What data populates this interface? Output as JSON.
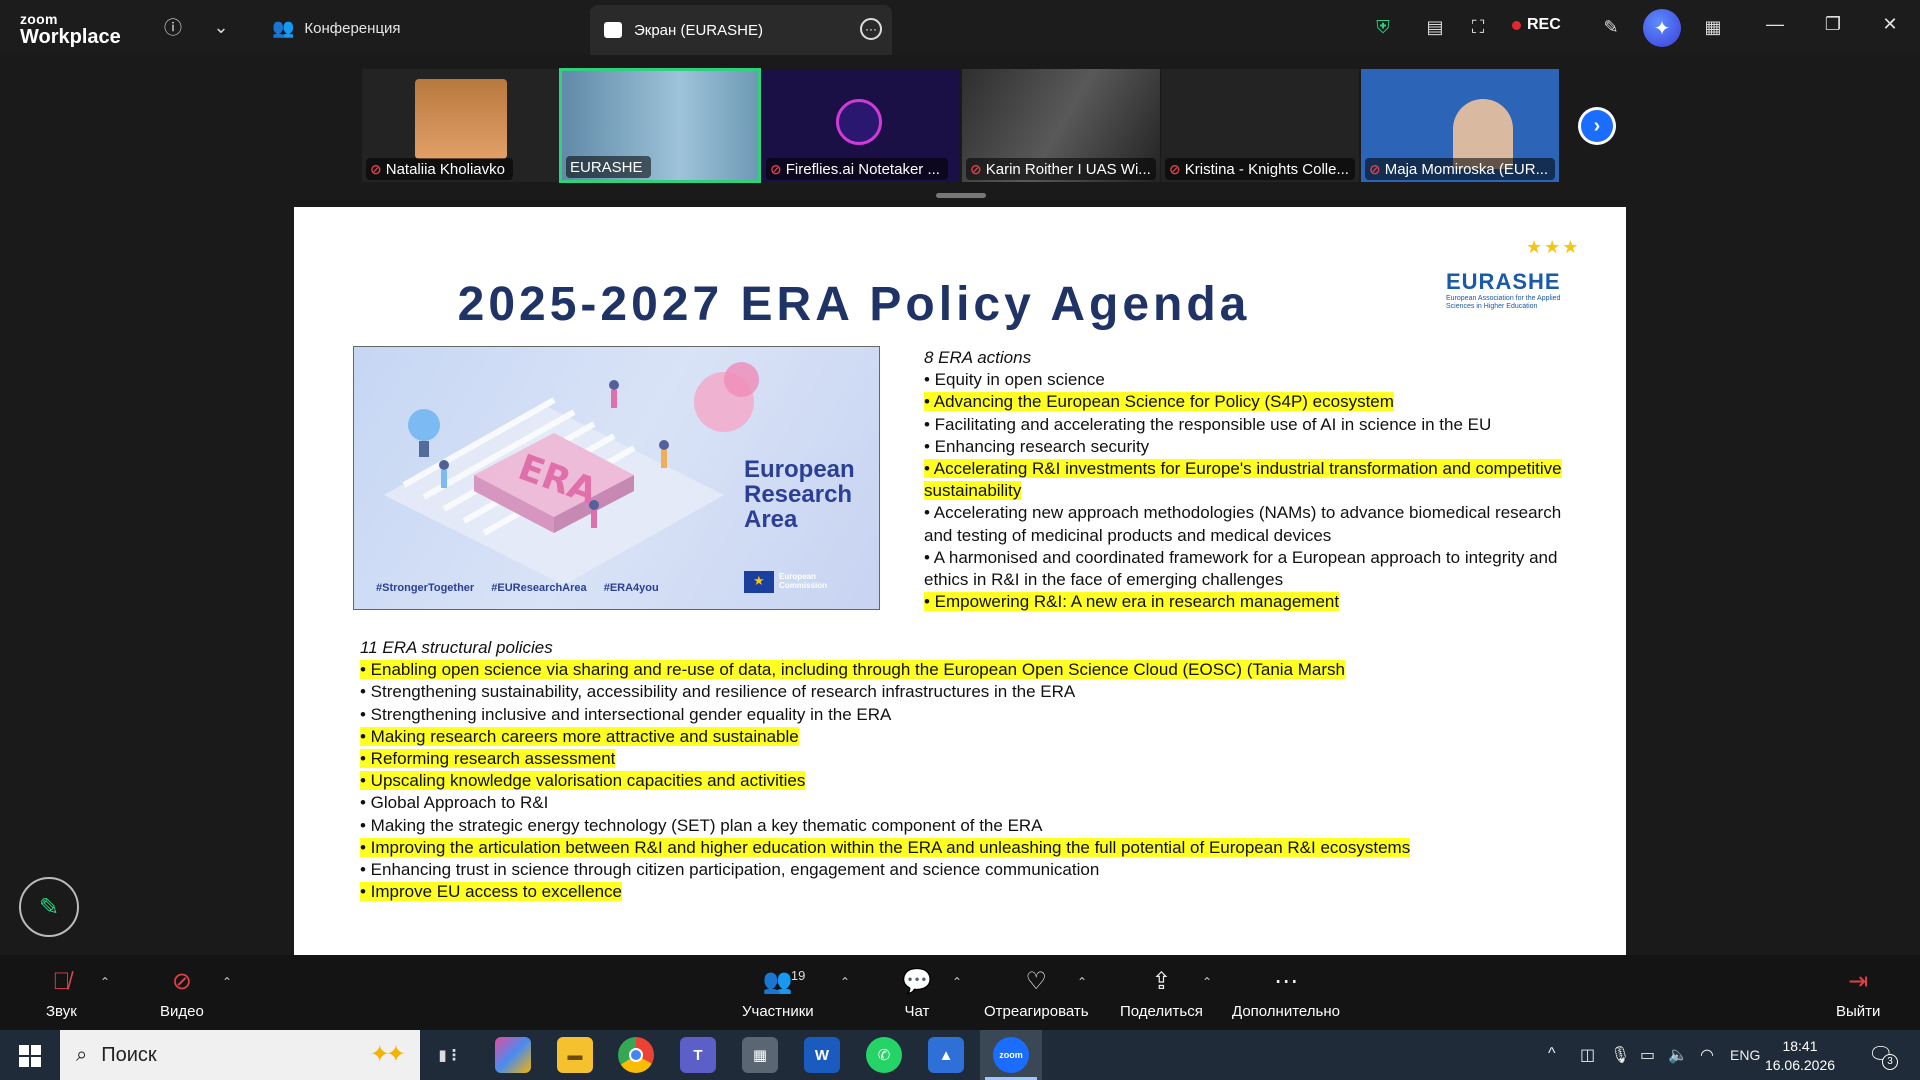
{
  "titlebar": {
    "brand_top": "zoom",
    "brand_bottom": "Workplace",
    "conference_tab": "Конференция",
    "screen_tab": "Экран (EURASHE)",
    "rec_label": "REC"
  },
  "participants": [
    {
      "name": "Nataliia Kholiavko",
      "muted": true
    },
    {
      "name": "EURASHE",
      "muted": false,
      "active": true
    },
    {
      "name": "Fireflies.ai Notetaker ...",
      "muted": true
    },
    {
      "name": "Karin Roither I UAS Wi...",
      "muted": true
    },
    {
      "name": "Kristina - Knights Colle...",
      "muted": true
    },
    {
      "name": "Maja Momiroska (EUR...",
      "muted": true
    }
  ],
  "slide": {
    "title": "2025-2027 ERA Policy Agenda",
    "logo_word": "EURASHE",
    "logo_sub": "European Association for the Applied Sciences in Higher Education",
    "image": {
      "era_letters": "ERA",
      "era_text_1": "European",
      "era_text_2": "Research",
      "era_text_3": "Area",
      "tags": "#StrongerTogether #EUResearchArea #ERA4you",
      "commission_1": "European",
      "commission_2": "Commission"
    },
    "actions_heading": "8 ERA actions",
    "actions": [
      {
        "text": "• Equity in open science",
        "highlight": false
      },
      {
        "text": "• Advancing the European Science for Policy (S4P) ecosystem",
        "highlight": true
      },
      {
        "text": "• Facilitating and accelerating the responsible use of AI in science in the EU",
        "highlight": false
      },
      {
        "text": "• Enhancing research security",
        "highlight": false
      },
      {
        "text": "• Accelerating R&I investments for Europe's industrial transformation and competitive sustainability",
        "highlight": true
      },
      {
        "text": "• Accelerating new approach methodologies (NAMs) to advance biomedical research and testing of medicinal products and medical devices",
        "highlight": false
      },
      {
        "text": "• A harmonised and coordinated framework for a European approach to integrity and ethics in R&I in the face of emerging challenges",
        "highlight": false
      },
      {
        "text": "• Empowering R&I: A new era in research management",
        "highlight": true
      }
    ],
    "policies_heading": "11 ERA structural policies",
    "policies": [
      {
        "text": "• Enabling open science via sharing and re-use of data, including through the European Open Science Cloud (EOSC) (Tania Marsh",
        "highlight": true
      },
      {
        "text": "• Strengthening sustainability, accessibility and resilience of research infrastructures in the ERA",
        "highlight": false
      },
      {
        "text": "• Strengthening inclusive and intersectional gender equality in the ERA",
        "highlight": false
      },
      {
        "text": "• Making research careers more attractive and sustainable",
        "highlight": true
      },
      {
        "text": "• Reforming research assessment",
        "highlight": true
      },
      {
        "text": "• Upscaling knowledge valorisation capacities and activities",
        "highlight": true
      },
      {
        "text": "• Global Approach to R&I",
        "highlight": false
      },
      {
        "text": "• Making the strategic energy technology (SET) plan a key thematic component of the ERA",
        "highlight": false
      },
      {
        "text": "• Improving the articulation between R&I and higher education within the ERA and unleashing the full potential of European R&I ecosystems",
        "highlight": true
      },
      {
        "text": "• Enhancing trust in science through citizen participation, engagement and science communication",
        "highlight": false
      },
      {
        "text": "• Improve EU access to excellence",
        "highlight": true
      }
    ]
  },
  "toolbar": {
    "audio": "Звук",
    "video": "Видео",
    "participants": "Участники",
    "participants_count": "19",
    "chat": "Чат",
    "react": "Отреагировать",
    "share": "Поделиться",
    "more": "Дополнительно",
    "leave": "Выйти"
  },
  "taskbar": {
    "search_placeholder": "Поиск",
    "lang": "ENG",
    "time": "18:41",
    "date": "16.06.2026",
    "notifications": "3"
  },
  "colors": {
    "highlight": "#ffff22",
    "title_navy": "#1f3366",
    "active_green": "#2fd17c",
    "zoom_blue": "#1a6dff"
  }
}
